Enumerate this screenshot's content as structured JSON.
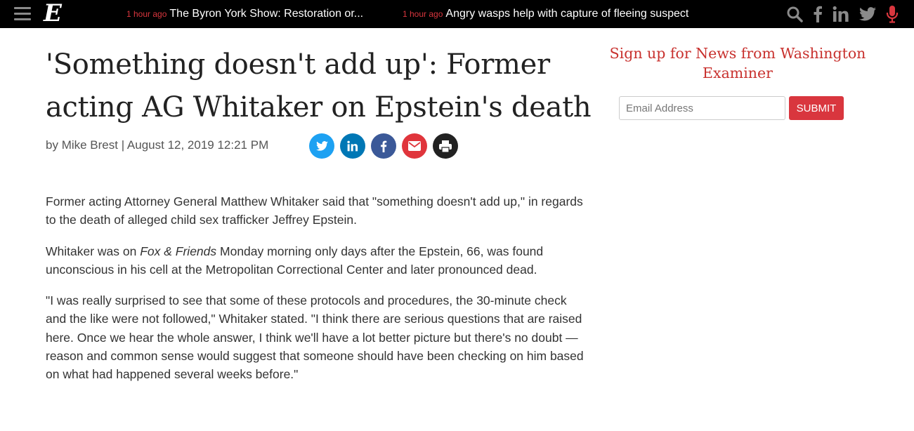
{
  "topbar": {
    "logo_letter": "E",
    "tickers": [
      {
        "time": "1 hour ago",
        "headline": "The Byron York Show: Restoration or..."
      },
      {
        "time": "1 hour ago",
        "headline": "Angry wasps help with capture of fleeing suspect"
      }
    ],
    "icons": [
      "search-icon",
      "facebook-icon",
      "linkedin-icon",
      "twitter-icon",
      "microphone-icon"
    ]
  },
  "article": {
    "headline": "'Something doesn't add up': Former acting AG Whitaker on Epstein's death",
    "byline_prefix": "by ",
    "author": "Mike Brest",
    "byline_separator": " | ",
    "date": "August 12, 2019 12:21 PM",
    "share_buttons": [
      "twitter",
      "linkedin",
      "facebook",
      "email",
      "print"
    ],
    "paragraphs": {
      "p1": "Former acting Attorney General Matthew Whitaker said that \"something doesn't add up,\" in regards to the death of alleged child sex trafficker Jeffrey Epstein.",
      "p2_pre": "Whitaker was on ",
      "p2_em": "Fox & Friends",
      "p2_post": " Monday morning only days after the Epstein, 66, was found unconscious in his cell at the Metropolitan Correctional Center and later pronounced dead.",
      "p3": "\"I was really surprised to see that some of these protocols and procedures, the 30-minute check and the like were not followed,\" Whitaker stated. \"I think there are serious questions that are raised here. Once we hear the whole answer, I think we'll have a lot better picture but there's no doubt — reason and common sense would suggest that someone should have been checking on him based on what had happened several weeks before.\""
    }
  },
  "sidebar": {
    "signup_title": "Sign up for News from Washington Examiner",
    "email_placeholder": "Email Address",
    "email_value": "",
    "submit_label": "SUBMIT"
  },
  "colors": {
    "accent_red": "#d9363e",
    "topbar_bg": "#000000",
    "twitter": "#1da1f2",
    "linkedin": "#0077b5",
    "facebook": "#3b5998",
    "email": "#e0353c",
    "print": "#222222"
  }
}
